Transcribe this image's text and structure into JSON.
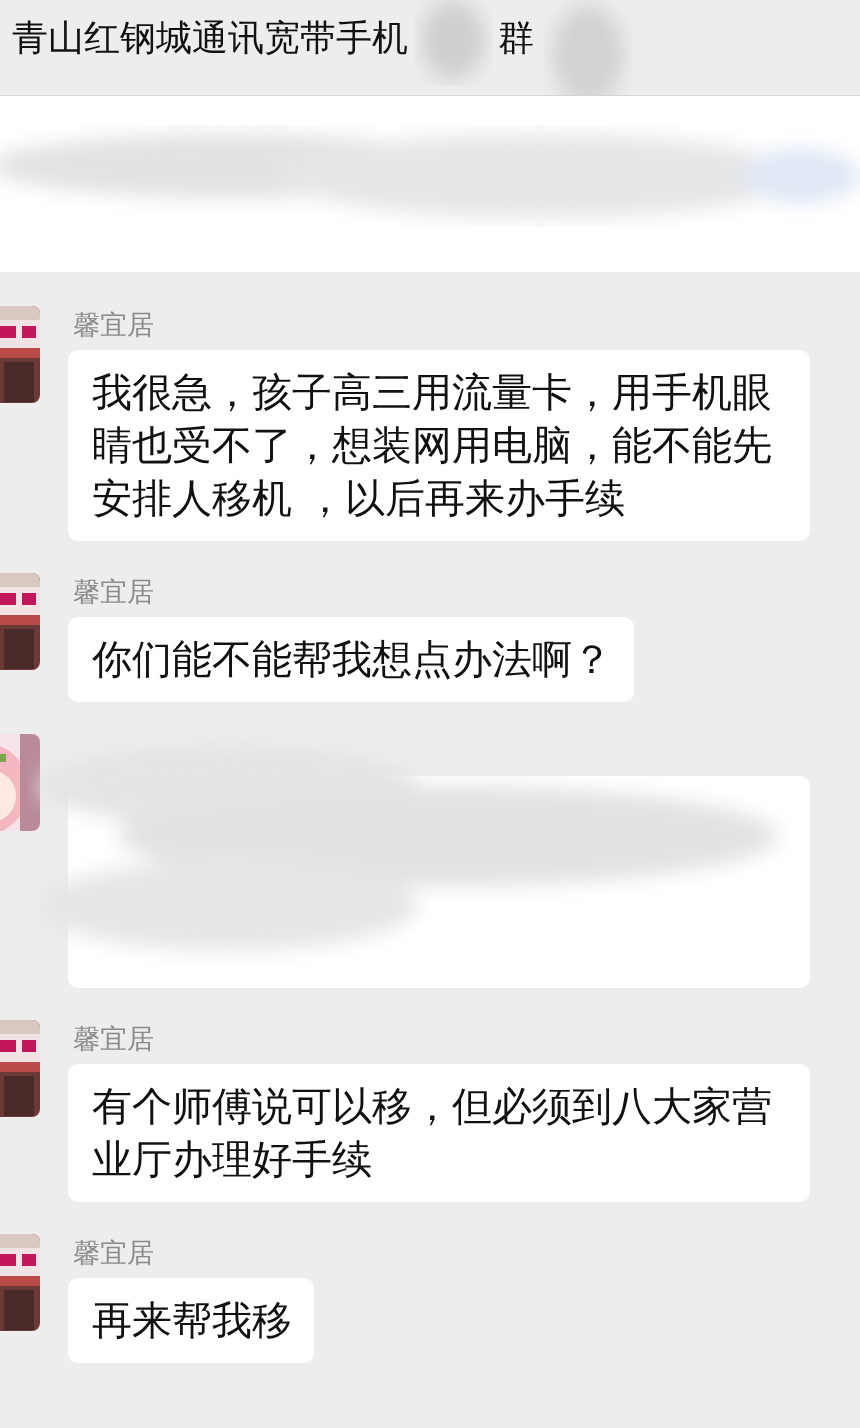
{
  "header": {
    "title_start": "青山红钢城通讯宽带手机",
    "title_end": "群",
    "redacted": true
  },
  "pinned": {
    "kind": "redacted"
  },
  "messages": [
    {
      "kind": "text",
      "sender": "馨宜居",
      "text": "我很急，孩子高三用流量卡，用手机眼睛也受不了，想装网用电脑，能不能先安排人移机 ，以后再来办手续"
    },
    {
      "kind": "text",
      "sender": "馨宜居",
      "text": "你们能不能帮我想点办法啊？"
    },
    {
      "kind": "redacted"
    },
    {
      "kind": "text",
      "sender": "馨宜居",
      "text": "有个师傅说可以移，但必须到八大家营业厅办理好手续"
    },
    {
      "kind": "text",
      "sender": "馨宜居",
      "text": "再来帮我移"
    }
  ]
}
